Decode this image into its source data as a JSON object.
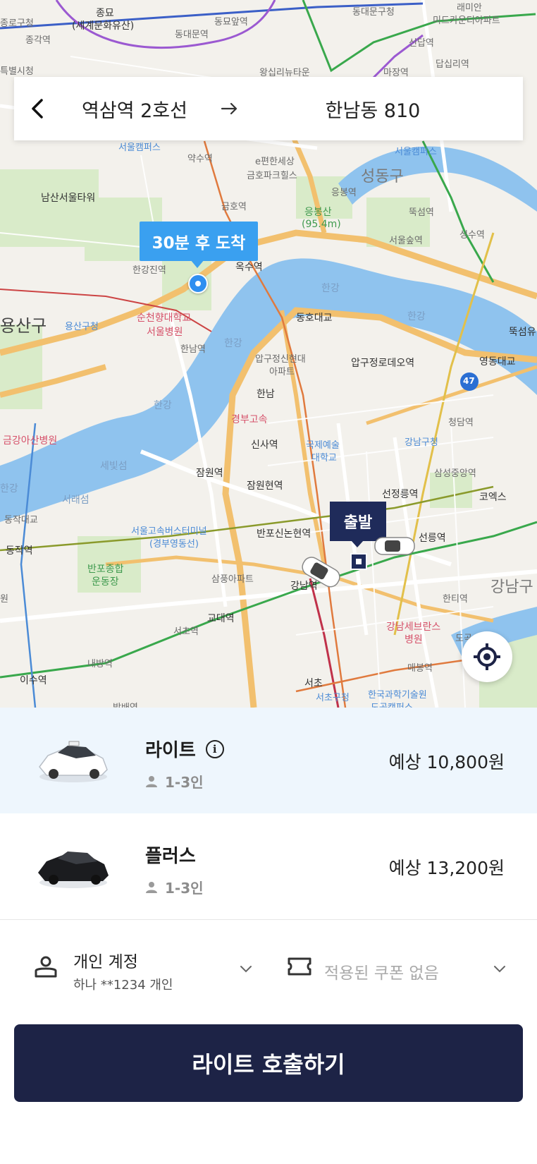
{
  "route": {
    "origin": "역삼역 2호선",
    "destination": "한남동 810"
  },
  "map": {
    "arrival_label": "30분 후 도착",
    "departure_label": "출발",
    "labels": {
      "jongno": "종로구청",
      "jonggak": "종각역",
      "jongmyo": "종묘",
      "jongmyo_sub": "(세계문화유산)",
      "dongdaemun": "동대문역",
      "dongmyo": "동묘앞역",
      "dongdaemun_gu": "동대문구청",
      "raemian": "래미안",
      "midcounty": "미드카운티아파트",
      "sindap": "신답역",
      "wangsimni": "왕십리뉴타운",
      "majang": "마장역",
      "dapsimni": "답십리역",
      "teukbyeolsi": "특별시청",
      "seoul_campus": "서울캠퍼스",
      "yaksu": "약수역",
      "ehansesang": "e편한세상",
      "geumho_park": "금호파크힐스",
      "seongdong": "성동구",
      "seoul_campus2": "서울캠퍼스",
      "namsan_tower": "남산서울타워",
      "geumho": "금호역",
      "eungbongsan": "응봉산",
      "eungbongsan_h": "(95.4m)",
      "eungbong": "응봉역",
      "ttukseom": "뚝섬역",
      "seongsu": "성수역",
      "seoulforest": "서울숲역",
      "hangangjin": "한강진역",
      "oksu": "옥수역",
      "yongsan_gu": "용산구",
      "yongsan_office": "용산구청",
      "soonchunhyang": "순천향대학교",
      "soonchunhyang2": "서울병원",
      "hannam_st": "한남역",
      "hangang1": "한강",
      "hangang2": "한강",
      "hangang3": "한강",
      "hangang4": "한강",
      "dongho_bridge": "동호대교",
      "apgujeong_hyundai": "압구정신현대",
      "apgujeong_hyundai2": "아파트",
      "apgujeong_rodeo": "압구정로데오역",
      "yeongdong_bridge": "영동대교",
      "ttukseom_park": "뚝섬유",
      "ic_hannam": "한남",
      "gyeongbu": "경부고속",
      "sinsa": "신사역",
      "kumc": "국제예술",
      "kumc2": "대학교",
      "gangnam_gu_office": "강남구청",
      "cheongdam": "청담역",
      "geumgang": "금강아산병원",
      "sebitseom": "세빛섬",
      "jamwon": "잠원역",
      "jamwon_ic": "잠원현역",
      "seonjeongneung": "선정릉역",
      "samseong_jungang": "삼성중앙역",
      "coex": "코엑스",
      "hangang5": "한강",
      "seoraeseom": "서래섬",
      "express_terminal": "서울고속버스터미널",
      "express_terminal2": "(경부영동선)",
      "banpo_ic": "반포신논현역",
      "seolleung": "선릉역",
      "dongjak_bridge": "동작대교",
      "dongjak": "동작역",
      "banpo_sports": "반포종합",
      "banpo_sports2": "운동장",
      "samhung": "삼풍아파트",
      "gangnam_st": "강남역",
      "gangnam_gu": "강남구",
      "hanti": "한티역",
      "seocho_office": "서초역",
      "gyodae": "교대역",
      "gangnam_severance": "강남세브란스",
      "gangnam_severance2": "병원",
      "naebang": "내방역",
      "maebong": "매봉역",
      "isu": "이수역",
      "seocho_ic": "서초",
      "seocho_gu": "서초구청",
      "science_museum": "한국과학기술원",
      "science_museum2": "도곡캠퍼스",
      "dogok": "도곡",
      "bangbae": "방배역",
      "wondae": "원",
      "hwy47": "47"
    }
  },
  "options": [
    {
      "name": "라이트",
      "capacity": "1-3인",
      "price": "예상 10,800원",
      "selected": true,
      "car_color": "white"
    },
    {
      "name": "플러스",
      "capacity": "1-3인",
      "price": "예상 13,200원",
      "selected": false,
      "car_color": "black"
    }
  ],
  "payment": {
    "account_title": "개인 계정",
    "account_sub": "하나 **1234 개인",
    "coupon": "적용된 쿠폰 없음"
  },
  "cta": {
    "label": "라이트 호출하기"
  },
  "colors": {
    "brand_dark": "#1d2346",
    "arrival_blue": "#3aa0f0",
    "depart_navy": "#1f2b5a",
    "selected_bg": "#eef6fd",
    "river": "#8fc3ee"
  }
}
